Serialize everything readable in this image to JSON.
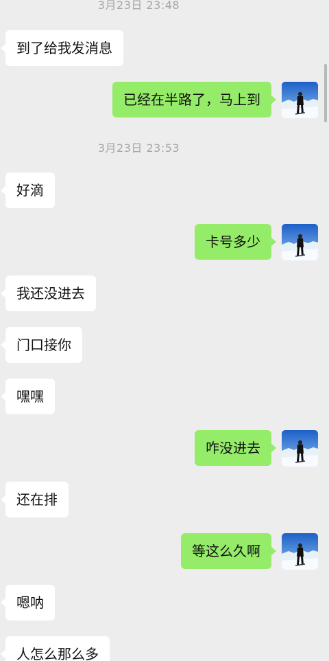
{
  "chat": {
    "timestamps": [
      "3月23日 23:48",
      "3月23日 23:53"
    ],
    "messages": [
      {
        "side": "left",
        "text": "到了给我发消息"
      },
      {
        "side": "right",
        "text": "已经在半路了，马上到"
      },
      {
        "side": "left",
        "text": "好滴"
      },
      {
        "side": "right",
        "text": "卡号多少"
      },
      {
        "side": "left",
        "text": "我还没进去"
      },
      {
        "side": "left",
        "text": "门口接你"
      },
      {
        "side": "left",
        "text": "嘿嘿"
      },
      {
        "side": "right",
        "text": "咋没进去"
      },
      {
        "side": "left",
        "text": "还在排"
      },
      {
        "side": "right",
        "text": "等这么久啊"
      },
      {
        "side": "left",
        "text": "嗯呐"
      },
      {
        "side": "left",
        "text": "人怎么那么多"
      }
    ]
  },
  "colors": {
    "background": "#ededed",
    "incoming_bubble": "#ffffff",
    "outgoing_bubble": "#95ec69",
    "timestamp_text": "#a6a6a6"
  },
  "icons": {
    "avatar": "snow-mountain-person-avatar"
  }
}
